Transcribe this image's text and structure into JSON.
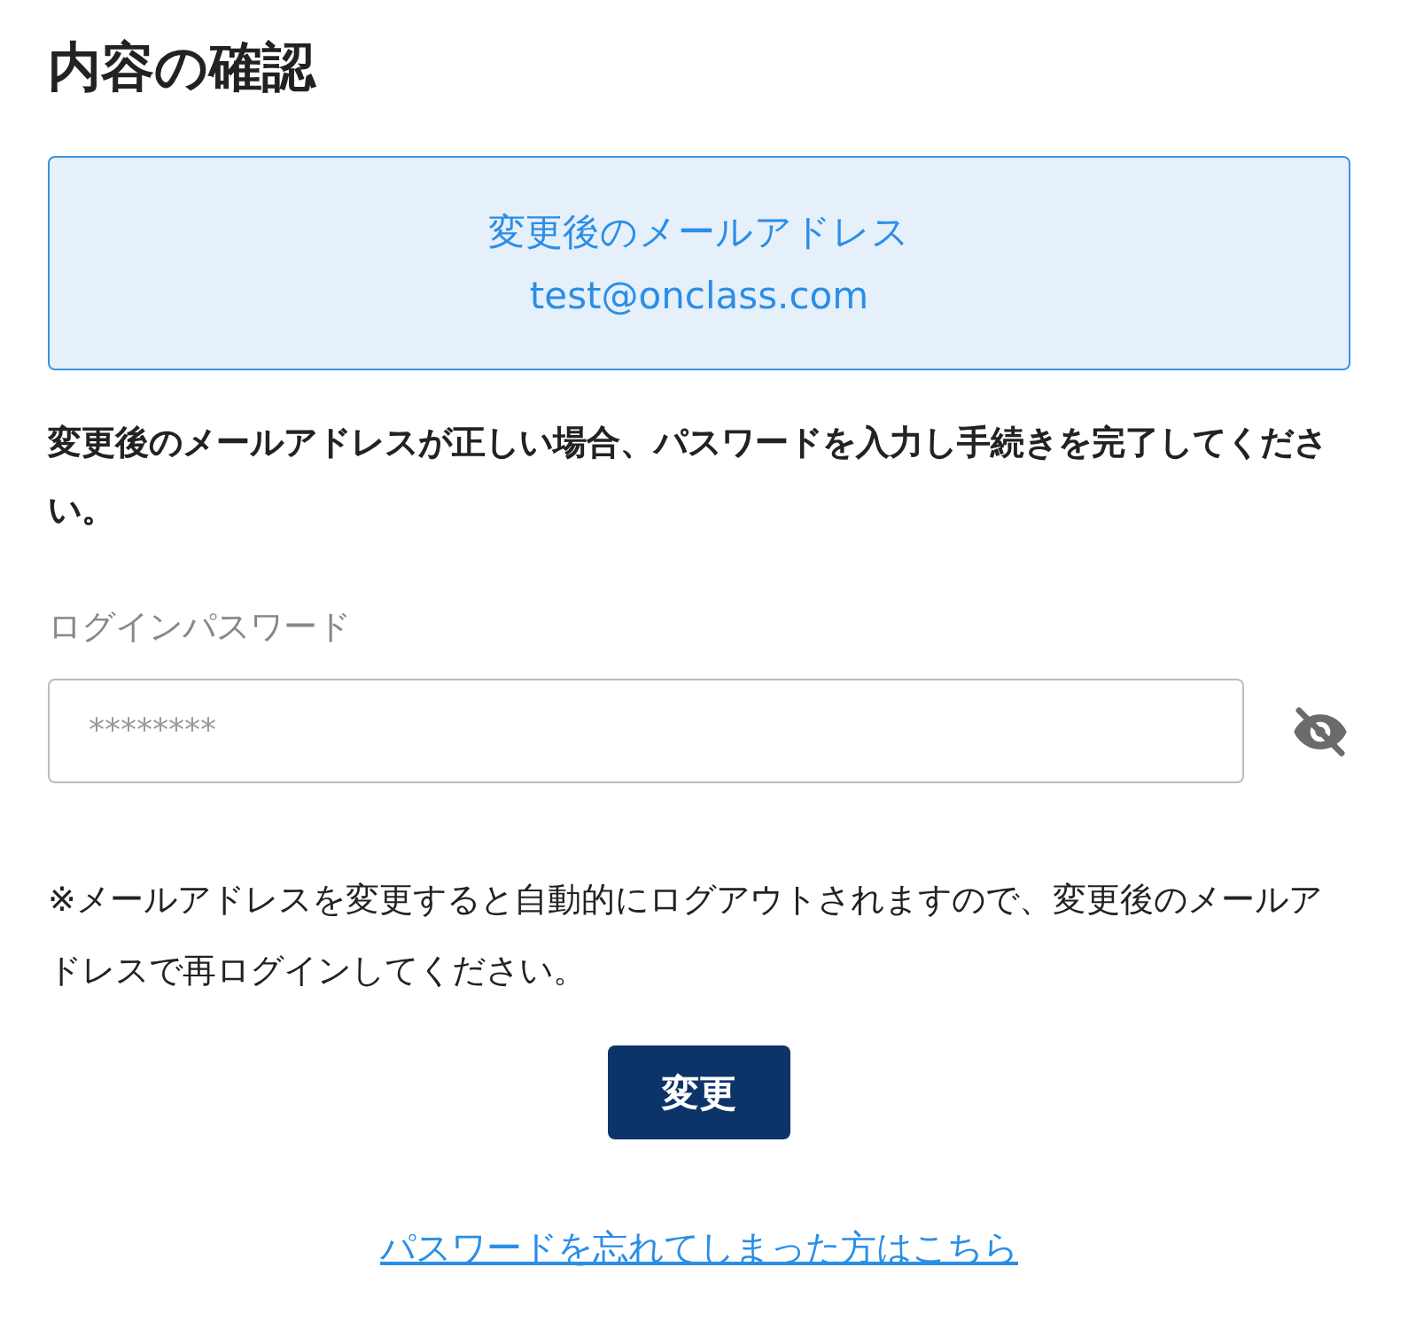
{
  "title": "内容の確認",
  "info_box": {
    "label": "変更後のメールアドレス",
    "email": "test@onclass.com"
  },
  "instruction": "変更後のメールアドレスが正しい場合、パスワードを入力し手続きを完了してください。",
  "password": {
    "label": "ログインパスワード",
    "placeholder": "********",
    "visible": false
  },
  "note": "※メールアドレスを変更すると自動的にログアウトされますので、変更後のメールアドレスで再ログインしてください。",
  "submit_button": "変更",
  "forgot_link": "パスワードを忘れてしまった方はこちら"
}
